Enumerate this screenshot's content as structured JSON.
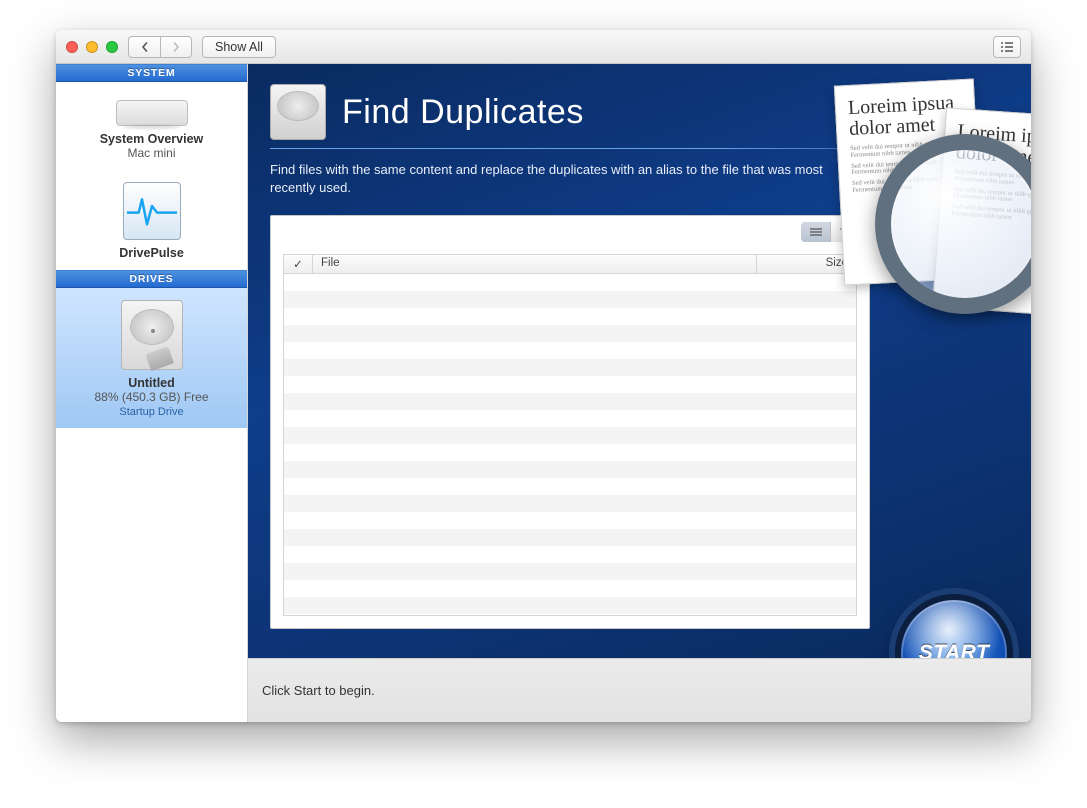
{
  "toolbar": {
    "show_all": "Show All"
  },
  "sidebar": {
    "system_header": "SYSTEM",
    "drives_header": "DRIVES",
    "overview": {
      "name": "System Overview",
      "model": "Mac mini"
    },
    "pulse": {
      "name": "DrivePulse"
    },
    "drive": {
      "name": "Untitled",
      "free": "88% (450.3 GB) Free",
      "role": "Startup Drive"
    }
  },
  "feature": {
    "title": "Find Duplicates",
    "description": "Find files with the same content and replace the duplicates with an alias to the file that was most recently used."
  },
  "table": {
    "check": "✓",
    "file": "File",
    "size": "Size"
  },
  "status": "Click Start to begin.",
  "start_label": "START",
  "paper": {
    "heading": "Loreim ipsua dolor amet",
    "body": "Sed velit dui tempor ut nibh quis. Fermentum nibh tames"
  }
}
